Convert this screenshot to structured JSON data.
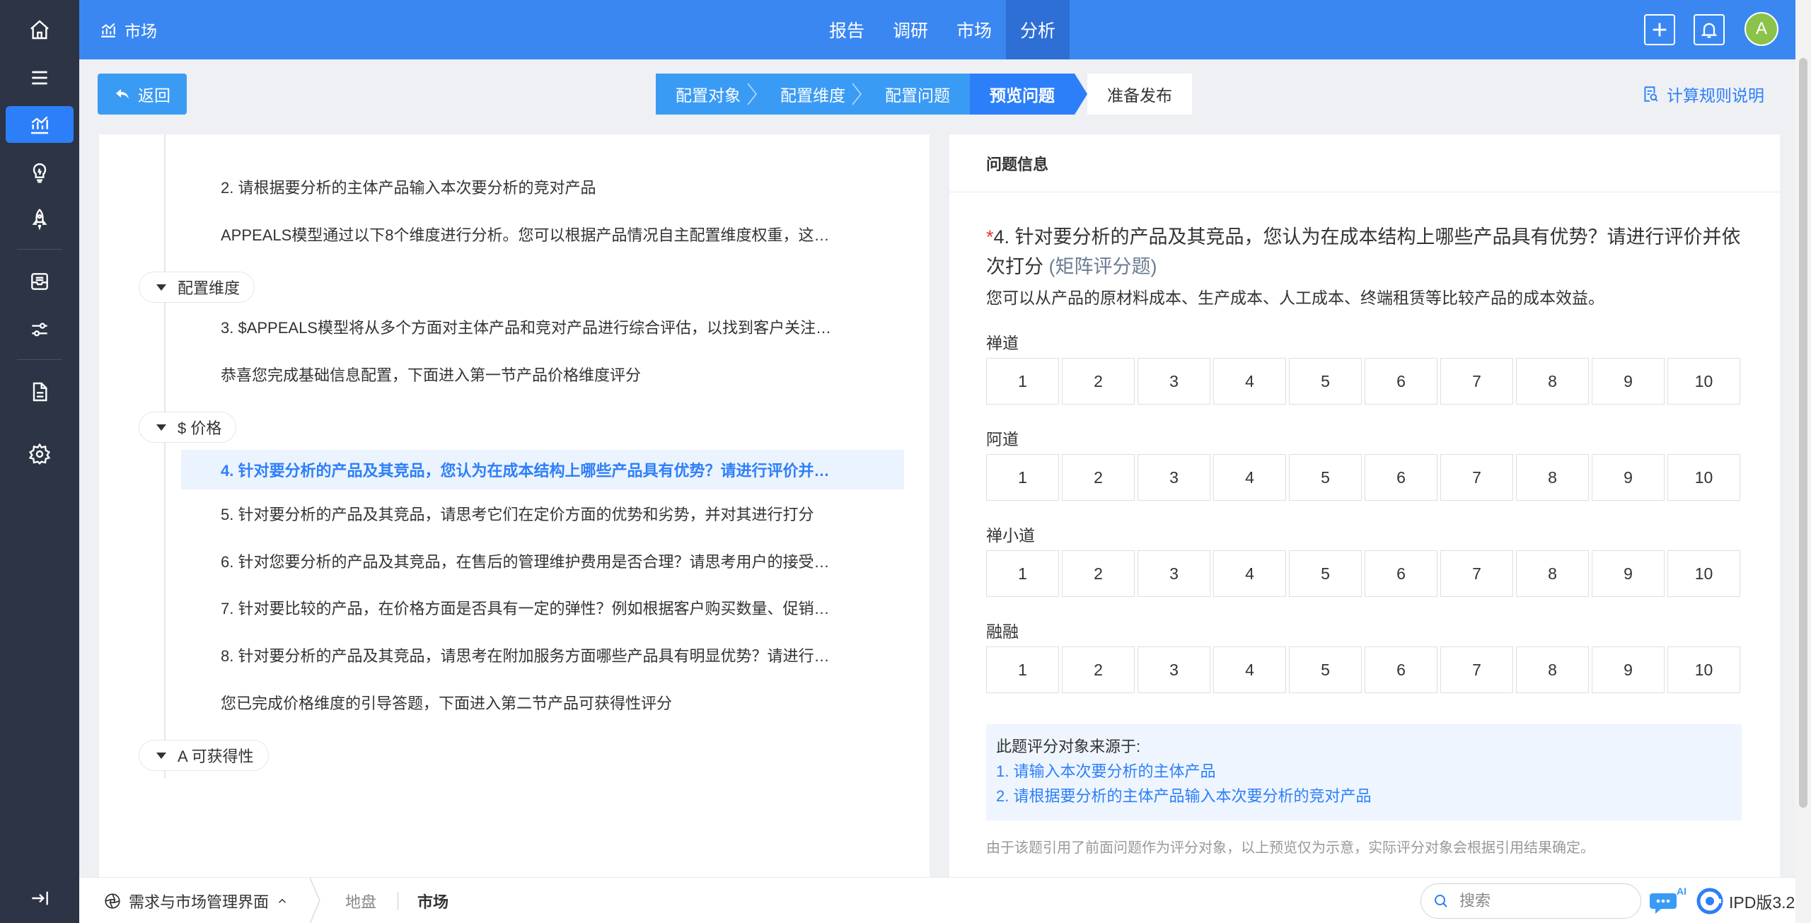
{
  "topbar": {
    "title": "市场",
    "nav": [
      "报告",
      "调研",
      "市场",
      "分析"
    ],
    "active_nav": "分析",
    "avatar_initial": "A"
  },
  "subheader": {
    "back_label": "返回",
    "steps": [
      "配置对象",
      "配置维度",
      "配置问题",
      "预览问题",
      "准备发布"
    ],
    "current_step": "预览问题",
    "rule_link": "计算规则说明"
  },
  "tree": {
    "item_2": "2. 请根据要分析的主体产品输入本次要分析的竞对产品",
    "intro": "APPEALS模型通过以下8个维度进行分析。您可以根据产品情况自主配置维度权重，这…",
    "group_dim": "配置维度",
    "item_3": "3. $APPEALS模型将从多个方面对主体产品和竞对产品进行综合评估，以找到客户关注…",
    "congrats": "恭喜您完成基础信息配置，下面进入第一节产品价格维度评分",
    "group_price": "$ 价格",
    "item_4": "4. 针对要分析的产品及其竞品，您认为在成本结构上哪些产品具有优势？请进行评价并…",
    "item_5": "5. 针对要分析的产品及其竞品，请思考它们在定价方面的优势和劣势，并对其进行打分",
    "item_6": "6. 针对您要分析的产品及其竞品，在售后的管理维护费用是否合理？请思考用户的接受…",
    "item_7": "7. 针对要比较的产品，在价格方面是否具有一定的弹性？例如根据客户购买数量、促销…",
    "item_8": "8. 针对要分析的产品及其竞品，请思考在附加服务方面哪些产品具有明显优势？请进行…",
    "price_done": "您已完成价格维度的引导答题，下面进入第二节产品可获得性评分",
    "group_avail": "A 可获得性"
  },
  "question": {
    "header": "问题信息",
    "required_mark": "*",
    "title": "4. 针对要分析的产品及其竞品，您认为在成本结构上哪些产品具有优势？请进行评价并依次打分",
    "type_label": "(矩阵评分题)",
    "description": "您可以从产品的原材料成本、生产成本、人工成本、终端租赁等比较产品的成本效益。",
    "rows": [
      "禅道",
      "阿道",
      "禅小道",
      "融融"
    ],
    "scale": [
      "1",
      "2",
      "3",
      "4",
      "5",
      "6",
      "7",
      "8",
      "9",
      "10"
    ],
    "source_title": "此题评分对象来源于:",
    "sources": [
      "1. 请输入本次要分析的主体产品",
      "2. 请根据要分析的主体产品输入本次要分析的竞对产品"
    ],
    "note": "由于该题引用了前面问题作为评分对象，以上预览仅为示意，实际评分对象会根据引用结果确定。"
  },
  "bottombar": {
    "app_name": "需求与市场管理界面",
    "crumbs": [
      "地盘",
      "市场"
    ],
    "search_placeholder": "搜索",
    "ai_label": "AI",
    "version": "IPD版3.2"
  },
  "colors": {
    "primary": "#3a87f2",
    "accent": "#2d7ff9",
    "sidebar": "#2c3445"
  },
  "icons": {
    "sidebar": [
      "home-icon",
      "menu-icon",
      "chart-icon",
      "lightbulb-icon",
      "rocket-icon",
      "inbox-icon",
      "settings-sliders-icon",
      "document-icon",
      "gear-icon",
      "collapse-icon"
    ]
  }
}
